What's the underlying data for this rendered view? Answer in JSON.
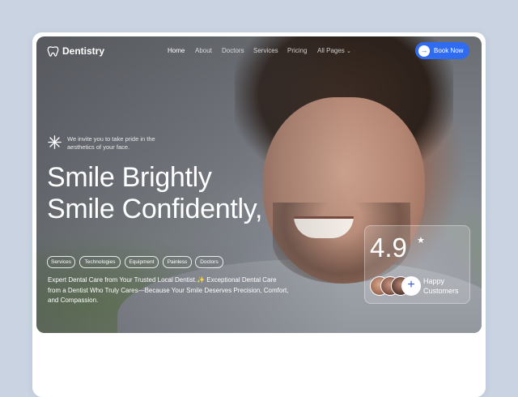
{
  "brand": {
    "name": "Dentistry"
  },
  "nav": {
    "items": [
      {
        "label": "Home",
        "active": true
      },
      {
        "label": "About",
        "active": false
      },
      {
        "label": "Doctors",
        "active": false
      },
      {
        "label": "Services",
        "active": false
      },
      {
        "label": "Pricing",
        "active": false
      },
      {
        "label": "All Pages",
        "active": false,
        "dropdown": true
      }
    ],
    "cta_label": "Book Now",
    "cta_color": "#2f6cf2"
  },
  "hero": {
    "invite_text": "We invite you to take pride in the aesthetics of your face.",
    "headline_line1": "Smile Brightly",
    "headline_line2": "Smile Confidently,",
    "tags": [
      "Services",
      "Technologies",
      "Equipment",
      "Painless",
      "Doctors"
    ],
    "description": "Expert Dental Care from Your Trusted Local Dentist.✨ Exceptional Dental Care from a Dentist Who Truly Cares—Because Your Smile Deserves Precision, Comfort, and Compassion."
  },
  "rating_card": {
    "rating": "4.9",
    "star": "★",
    "label": "Happy Customers",
    "plus": "+"
  },
  "icons": {
    "logo": "tooth-icon",
    "cta": "arrow-right-icon",
    "invite": "sparkle-icon",
    "dropdown": "chevron-down-icon"
  }
}
